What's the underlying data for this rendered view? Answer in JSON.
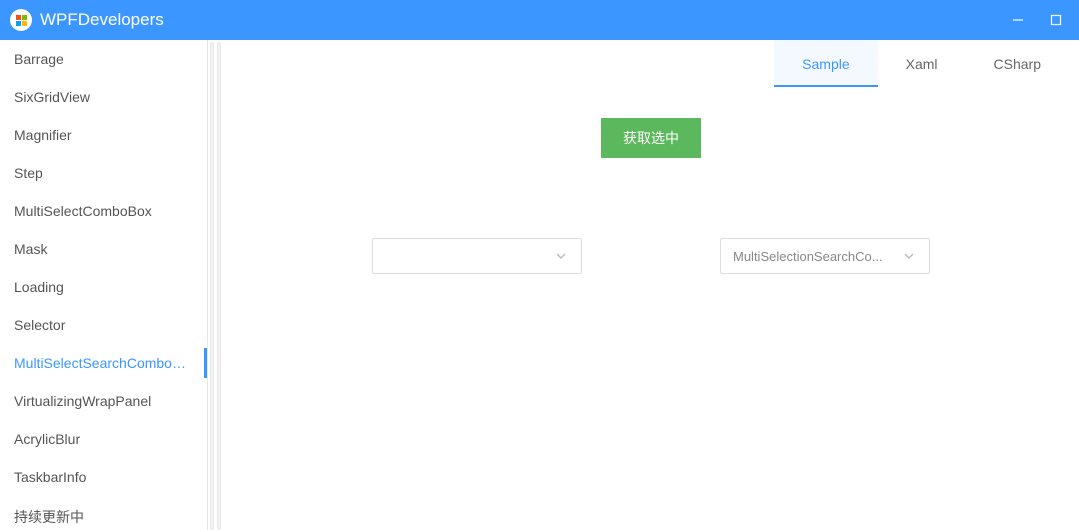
{
  "titlebar": {
    "app_name": "WPFDevelopers",
    "logo_label": "WPF"
  },
  "sidebar": {
    "items": [
      {
        "label": "Barrage",
        "active": false
      },
      {
        "label": "SixGridView",
        "active": false
      },
      {
        "label": "Magnifier",
        "active": false
      },
      {
        "label": "Step",
        "active": false
      },
      {
        "label": "MultiSelectComboBox",
        "active": false
      },
      {
        "label": "Mask",
        "active": false
      },
      {
        "label": "Loading",
        "active": false
      },
      {
        "label": "Selector",
        "active": false
      },
      {
        "label": "MultiSelectSearchComboBox",
        "active": true
      },
      {
        "label": "VirtualizingWrapPanel",
        "active": false
      },
      {
        "label": "AcrylicBlur",
        "active": false
      },
      {
        "label": "TaskbarInfo",
        "active": false
      },
      {
        "label": "持续更新中",
        "active": false
      }
    ]
  },
  "tabs": [
    {
      "label": "Sample",
      "active": true
    },
    {
      "label": "Xaml",
      "active": false
    },
    {
      "label": "CSharp",
      "active": false
    }
  ],
  "main": {
    "action_button": "获取选中",
    "combo1": {
      "placeholder": ""
    },
    "combo2": {
      "placeholder": "MultiSelectionSearchCo..."
    }
  }
}
